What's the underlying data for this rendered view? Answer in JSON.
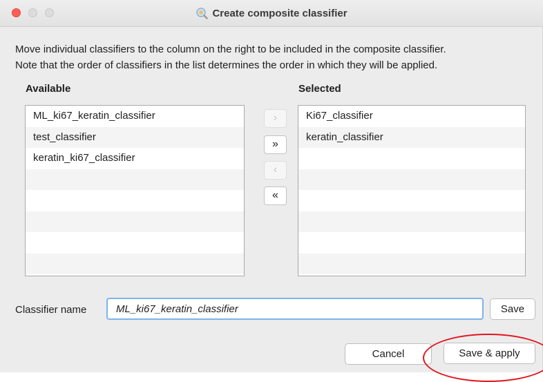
{
  "window": {
    "title": "Create composite classifier"
  },
  "description": {
    "line1": "Move individual classifiers to the column on the right to be included in the composite classifier.",
    "line2": "Note that the order of classifiers in the list determines the order in which they will be applied."
  },
  "available": {
    "label": "Available",
    "items": [
      "ML_ki67_keratin_classifier",
      "test_classifier",
      "keratin_ki67_classifier",
      "",
      "",
      "",
      "",
      ""
    ]
  },
  "selected": {
    "label": "Selected",
    "items": [
      "Ki67_classifier",
      "keratin_classifier",
      "",
      "",
      "",
      "",
      "",
      ""
    ]
  },
  "move_buttons": {
    "add_one": "›",
    "add_all": "»",
    "remove_one": "‹",
    "remove_all": "«"
  },
  "classifier_name": {
    "label": "Classifier name",
    "value": "ML_ki67_keratin_classifier",
    "save_label": "Save"
  },
  "footer": {
    "cancel_label": "Cancel",
    "save_apply_label": "Save & apply"
  },
  "colors": {
    "close": "#ff5f57",
    "focus_ring": "#7db3ec",
    "annotation": "#e3141c"
  }
}
